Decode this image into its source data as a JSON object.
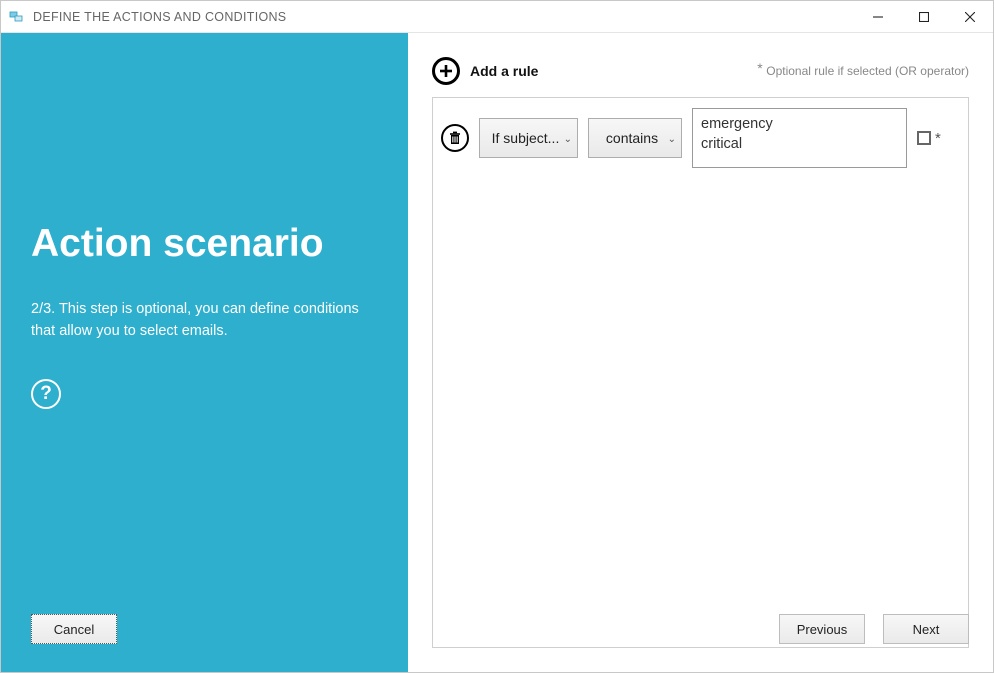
{
  "window": {
    "title": "DEFINE THE ACTIONS AND CONDITIONS"
  },
  "sidebar": {
    "heading": "Action scenario",
    "description": "2/3. This step is optional, you can define conditions that allow you to select emails.",
    "help_tooltip": "?",
    "cancel_label": "Cancel"
  },
  "main": {
    "add_rule_label": "Add a rule",
    "optional_hint": "Optional rule if selected (OR operator)",
    "rules": [
      {
        "field_label": "If subject...",
        "operator_label": "contains",
        "value": "emergency\ncritical",
        "optional_marker": "*"
      }
    ]
  },
  "nav": {
    "previous_label": "Previous",
    "next_label": "Next"
  }
}
